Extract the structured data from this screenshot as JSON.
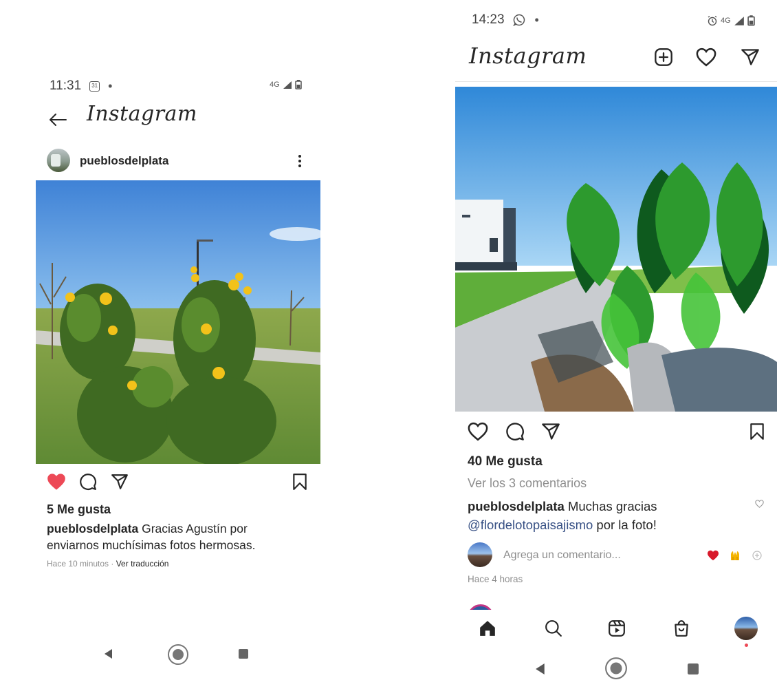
{
  "left": {
    "status": {
      "time": "11:31",
      "calendar_day": "31",
      "network": "4G"
    },
    "app_title": "Instagram",
    "post": {
      "username": "pueblosdelplata",
      "likes": "5 Me gusta",
      "caption_user": "pueblosdelplata",
      "caption_text": " Gracias Agustín por enviarnos muchísimas fotos hermosas.",
      "time_ago": "Hace 10 minutos",
      "separator": " · ",
      "translate": "Ver traducción",
      "liked": true
    }
  },
  "right": {
    "status": {
      "time": "14:23",
      "network": "4G"
    },
    "app_title": "Instagram",
    "post": {
      "likes": "40 Me gusta",
      "view_comments": "Ver los 3 comentarios",
      "comment_user": "pueblosdelplata",
      "comment_text": " Muchas gracias",
      "mention": "@flordelotopaisajismo",
      "comment_text_end": " por la foto!",
      "add_comment_placeholder": "Agrega un comentario...",
      "time_ago": "Hace 4 horas",
      "quick_reactions": [
        "❤️",
        "🙌"
      ]
    }
  },
  "colors": {
    "like_red": "#ed4956",
    "text": "#262626",
    "muted": "#8e8e8e",
    "link": "#385185"
  }
}
